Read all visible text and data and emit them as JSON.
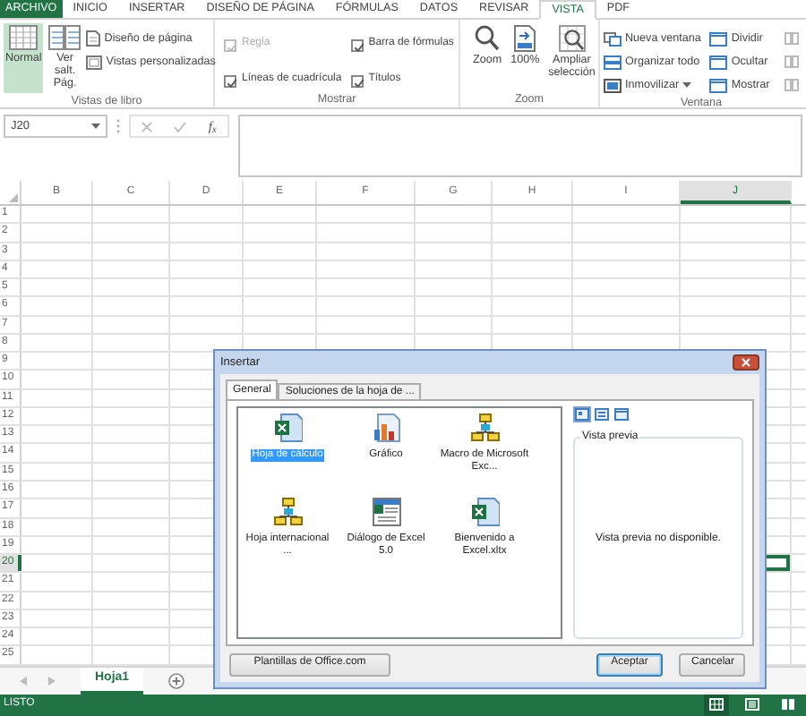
{
  "ribbon_tabs": [
    {
      "label": "ARCHIVO",
      "kind": "file",
      "selected": false
    },
    {
      "label": "INICIO",
      "kind": "tab",
      "selected": false
    },
    {
      "label": "INSERTAR",
      "kind": "tab",
      "selected": false
    },
    {
      "label": "DISEÑO DE PÁGINA",
      "kind": "tab",
      "selected": false
    },
    {
      "label": "FÓRMULAS",
      "kind": "tab",
      "selected": false
    },
    {
      "label": "DATOS",
      "kind": "tab",
      "selected": false
    },
    {
      "label": "REVISAR",
      "kind": "tab",
      "selected": false
    },
    {
      "label": "VISTA",
      "kind": "tab",
      "selected": true
    },
    {
      "label": "PDF",
      "kind": "tab",
      "selected": false
    }
  ],
  "workbook_views": {
    "label": "Vistas de libro",
    "large_buttons": [
      {
        "label": "Normal",
        "selected": true
      },
      {
        "label": "Ver salt. Pág.",
        "selected": false
      }
    ],
    "small_buttons": [
      "Diseño de página",
      "Vistas personalizadas"
    ]
  },
  "show": {
    "label": "Mostrar",
    "checkboxes": [
      {
        "label": "Regla",
        "checked": true,
        "disabled": true
      },
      {
        "label": "Barra de fórmulas",
        "checked": true,
        "disabled": false
      },
      {
        "label": "Líneas de cuadrícula",
        "checked": true,
        "disabled": false
      },
      {
        "label": "Títulos",
        "checked": true,
        "disabled": false
      }
    ]
  },
  "zoom": {
    "label": "Zoom",
    "buttons": [
      "Zoom",
      "100%",
      "Ampliar selección"
    ]
  },
  "window_group": {
    "label": "Ventana",
    "commands": [
      {
        "label": "Nueva ventana",
        "menu": false
      },
      {
        "label": "Organizar todo",
        "menu": false
      },
      {
        "label": "Inmovilizar",
        "menu": true
      },
      {
        "label": "Dividir",
        "menu": false
      },
      {
        "label": "Ocultar",
        "menu": false
      },
      {
        "label": "Mostrar",
        "menu": false
      }
    ],
    "side_buttons": [
      {
        "disabled": true
      },
      {
        "disabled": true
      },
      {
        "disabled": true
      }
    ]
  },
  "formula_bar": {
    "name_box": "J20",
    "function_button": "f$_{x}$"
  },
  "sheet": {
    "columns": [
      {
        "label": "B",
        "selected": false
      },
      {
        "label": "C",
        "selected": false
      },
      {
        "label": "D",
        "selected": false
      },
      {
        "label": "E",
        "selected": false
      },
      {
        "label": "F",
        "selected": false
      },
      {
        "label": "G",
        "selected": false
      },
      {
        "label": "H",
        "selected": false
      },
      {
        "label": "I",
        "selected": false
      },
      {
        "label": "J",
        "selected": true
      }
    ],
    "rows": [
      {
        "label": "1",
        "selected": false
      },
      {
        "label": "2",
        "selected": false
      },
      {
        "label": "3",
        "selected": false
      },
      {
        "label": "4",
        "selected": false
      },
      {
        "label": "5",
        "selected": false
      },
      {
        "label": "6",
        "selected": false
      },
      {
        "label": "7",
        "selected": false
      },
      {
        "label": "8",
        "selected": false
      },
      {
        "label": "9",
        "selected": false
      },
      {
        "label": "10",
        "selected": false
      },
      {
        "label": "11",
        "selected": false
      },
      {
        "label": "12",
        "selected": false
      },
      {
        "label": "13",
        "selected": false
      },
      {
        "label": "14",
        "selected": false
      },
      {
        "label": "15",
        "selected": false
      },
      {
        "label": "16",
        "selected": false
      },
      {
        "label": "17",
        "selected": false
      },
      {
        "label": "18",
        "selected": false
      },
      {
        "label": "19",
        "selected": false
      },
      {
        "label": "20",
        "selected": true
      },
      {
        "label": "21",
        "selected": false
      },
      {
        "label": "22",
        "selected": false
      },
      {
        "label": "23",
        "selected": false
      },
      {
        "label": "24",
        "selected": false
      },
      {
        "label": "25",
        "selected": false
      }
    ]
  },
  "sheet_tabs": [
    {
      "label": "Hoja1",
      "selected": true
    }
  ],
  "status_bar": {
    "text": "LISTO",
    "views": [
      {
        "selected": true
      },
      {
        "selected": false
      },
      {
        "selected": false
      }
    ]
  },
  "dialog": {
    "title": "Insertar",
    "tabs": [
      {
        "label": "General",
        "selected": true
      },
      {
        "label": "Soluciones de la hoja de ...",
        "selected": false
      }
    ],
    "templates": [
      {
        "label": "Hoja de cálculo",
        "kind": "sheet",
        "selected": true
      },
      {
        "label": "Gráfico",
        "kind": "chart",
        "selected": false
      },
      {
        "label": "Macro de Microsoft Exc...",
        "kind": "macro",
        "selected": false
      },
      {
        "label": "Hoja internacional ...",
        "kind": "macro",
        "selected": false
      },
      {
        "label": "Diálogo de Excel 5.0",
        "kind": "dialog",
        "selected": false
      },
      {
        "label": "Bienvenido a Excel.xltx",
        "kind": "sheet",
        "selected": false
      }
    ],
    "view_buttons": [
      {
        "selected": true
      },
      {
        "selected": false
      },
      {
        "selected": false
      }
    ],
    "preview": {
      "legend": "Vista previa",
      "message": "Vista previa no disponible."
    },
    "buttons": [
      {
        "label": "Plantillas de Office.com",
        "default": false
      },
      {
        "label": "Aceptar",
        "default": true
      },
      {
        "label": "Cancelar",
        "default": false
      }
    ]
  }
}
